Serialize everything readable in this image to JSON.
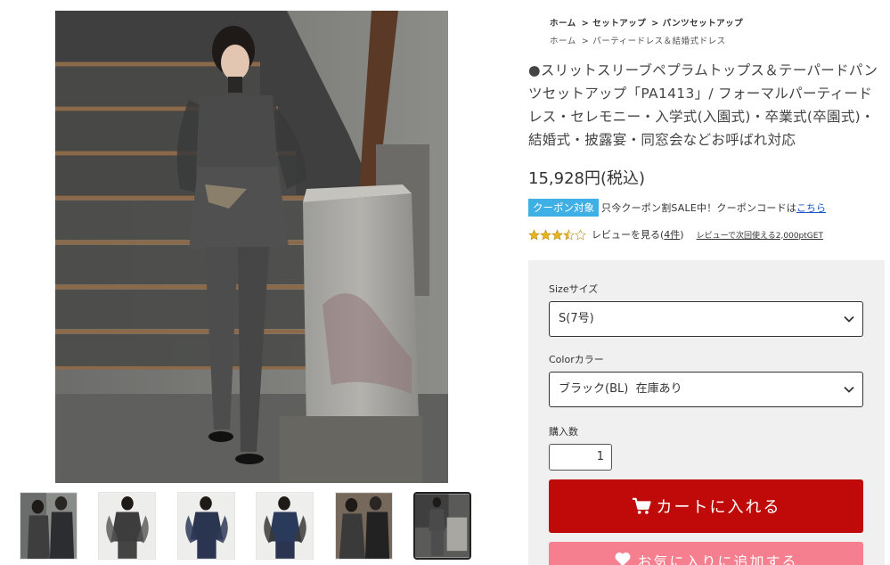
{
  "breadcrumbs": [
    {
      "items": [
        "ホーム",
        "セットアップ",
        "パンツセットアップ"
      ]
    },
    {
      "items": [
        "ホーム",
        "パーティードレス＆結婚式ドレス"
      ]
    }
  ],
  "breadcrumb_separator": ">",
  "product": {
    "title": "●スリットスリーブペプラムトップス＆テーパードパンツセットアップ「PA1413」/ フォーマルパーティードレス・セレモニー・入学式(入園式)・卒業式(卒園式)・結婚式・披露宴・同窓会などお呼ばれ対応",
    "price": "15,928円(税込)"
  },
  "coupon": {
    "badge": "クーポン対象",
    "text": "只今クーポン割SALE中！クーポンコードは",
    "link": "こちら",
    "badge_color": "#3fb0e6"
  },
  "reviews": {
    "rating": 3.5,
    "max": 5,
    "label": "レビューを見る(",
    "count": "4件",
    "close": ")",
    "point_link": "レビューで次回使える2,000ptGET",
    "star_color": "#e6b422"
  },
  "options": {
    "size_label": "Sizeサイズ",
    "size_value": "S(7号)",
    "color_label": "Colorカラー",
    "color_value": "ブラック(BL)  在庫あり",
    "qty_label": "購入数",
    "qty_value": "1"
  },
  "actions": {
    "cart_label": "カートに入れる",
    "cart_color": "#c00a0a",
    "favorite_label": "お気に入りに追加する",
    "favorite_color": "#f57f8f"
  },
  "thumbnails": {
    "count": 6,
    "active_index": 5
  }
}
